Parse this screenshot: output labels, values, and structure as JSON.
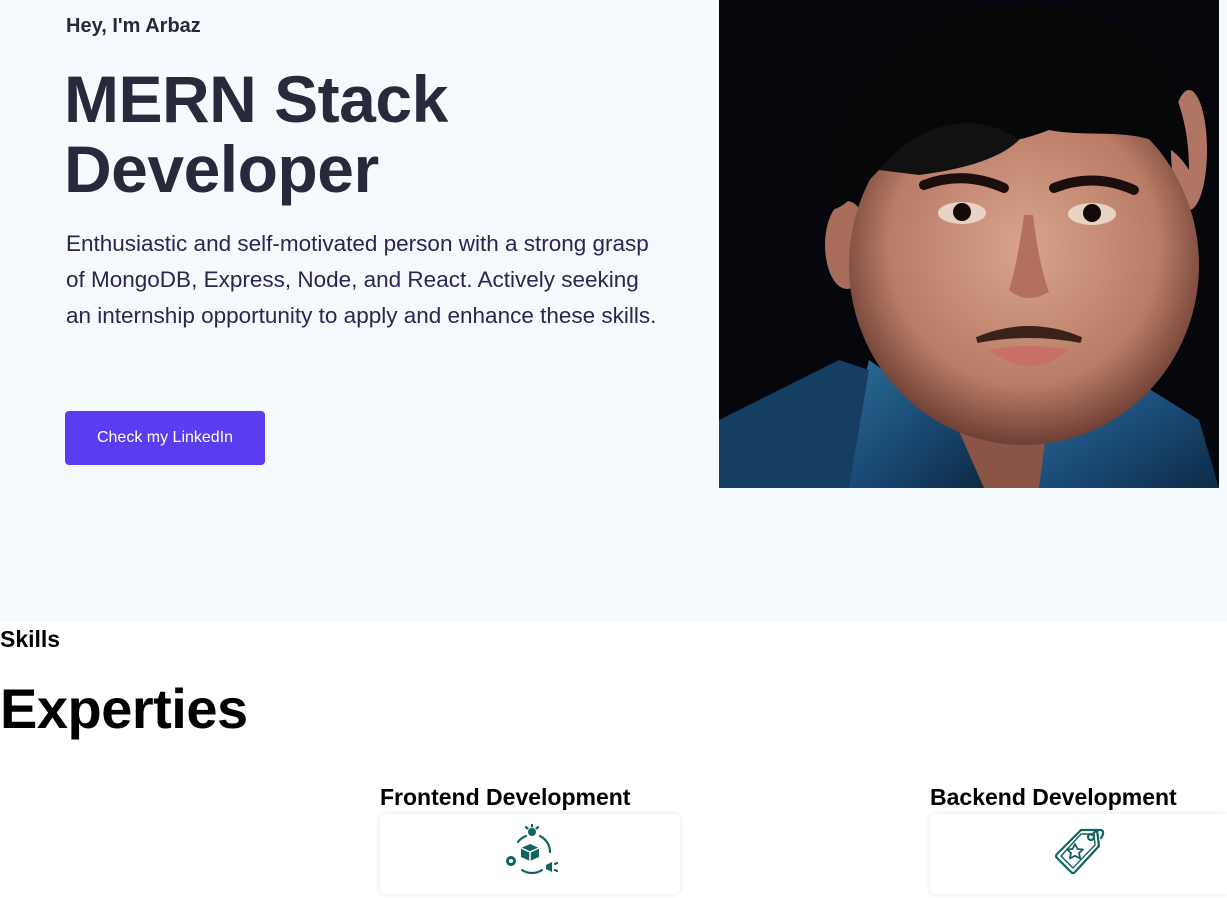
{
  "hero": {
    "greeting": "Hey, I'm Arbaz",
    "headline": "MERN Stack Developer",
    "intro": "Enthusiastic and self-motivated person with a strong grasp of MongoDB, Express, Node, and React. Actively seeking an internship opportunity to apply and enhance these skills.",
    "cta_label": "Check my LinkedIn"
  },
  "skills": {
    "label": "Skills",
    "title": "Experties",
    "items": [
      {
        "title": "Frontend Development",
        "icon": "product-cycle-icon"
      },
      {
        "title": "Backend Development",
        "icon": "tag-icon"
      }
    ]
  },
  "colors": {
    "hero_background": "#f4fafe",
    "heading_text": "#262a3a",
    "body_text": "#29264f",
    "accent_button": "#5b3cf0",
    "icon_teal": "#11635f"
  }
}
